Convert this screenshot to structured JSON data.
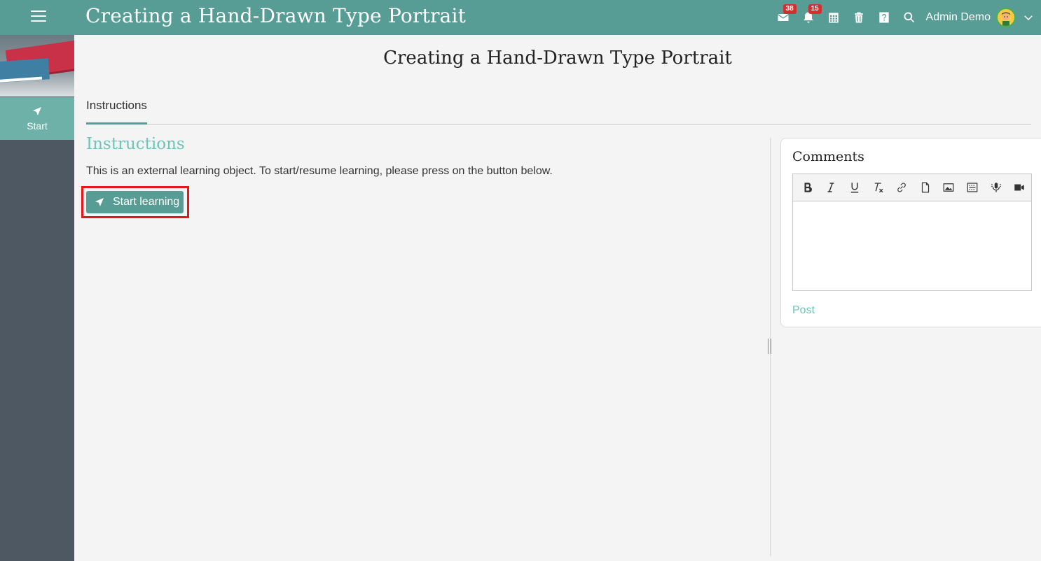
{
  "header": {
    "app_title": "Creating a Hand-Drawn Type Portrait",
    "messages_count": "38",
    "notifications_count": "15",
    "user_name": "Admin Demo"
  },
  "sidebar": {
    "start_label": "Start"
  },
  "main": {
    "page_title": "Creating a Hand-Drawn Type Portrait",
    "tabs": [
      {
        "label": "Instructions"
      }
    ],
    "section_title": "Instructions",
    "description": "This is an external learning object. To start/resume learning, please press on the button below.",
    "start_button_label": "Start learning"
  },
  "comments": {
    "title": "Comments",
    "post_label": "Post",
    "toolbar": [
      "bold",
      "italic",
      "underline",
      "remove-format",
      "link",
      "file",
      "image",
      "embed",
      "record-audio",
      "record-video"
    ]
  },
  "colors": {
    "primary": "#579d95",
    "accent": "#6cc5b8",
    "sidebar": "#4e5862",
    "highlight": "#e8161b",
    "badge": "#d32f2f"
  }
}
